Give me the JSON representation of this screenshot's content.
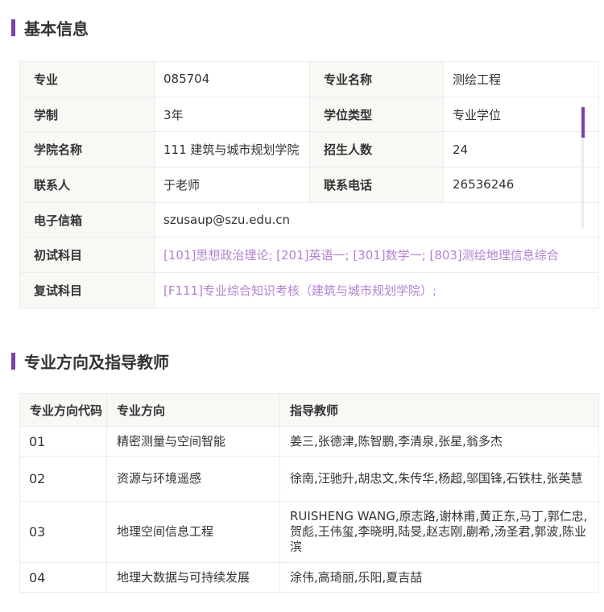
{
  "sections": {
    "basic_title": "基本信息",
    "directions_title": "专业方向及指导教师"
  },
  "basic": {
    "rows": [
      {
        "l1": "专业",
        "v1": "085704",
        "l2": "专业名称",
        "v2": "测绘工程"
      },
      {
        "l1": "学制",
        "v1": "3年",
        "l2": "学位类型",
        "v2": "专业学位"
      },
      {
        "l1": "学院名称",
        "v1": "111 建筑与城市规划学院",
        "l2": "招生人数",
        "v2": "24"
      },
      {
        "l1": "联系人",
        "v1": "于老师",
        "l2": "联系电话",
        "v2": "26536246"
      }
    ],
    "email_label": "电子信箱",
    "email_value": "szusaup@szu.edu.cn",
    "exam_label": "初试科目",
    "exam_value": "[101]思想政治理论;  [201]英语一;  [301]数学一;  [803]测绘地理信息综合",
    "retest_label": "复试科目",
    "retest_value": "[F111]专业综合知识考核（建筑与城市规划学院）;"
  },
  "directions": {
    "headers": [
      "专业方向代码",
      "专业方向",
      "指导教师"
    ],
    "rows": [
      {
        "code": "01",
        "name": "精密测量与空间智能",
        "teachers": "姜三,张德津,陈智鹏,李清泉,张星,翁多杰"
      },
      {
        "code": "02",
        "name": "资源与环境遥感",
        "teachers": "徐南,汪驰升,胡忠文,朱传华,杨超,邬国锋,石铁柱,张英慧"
      },
      {
        "code": "03",
        "name": "地理空间信息工程",
        "teachers": "RUISHENG WANG,原志路,谢林甫,黄正东,马丁,郭仁忠,贺彪,王伟玺,李晓明,陆旻,赵志刚,蒯希,汤圣君,郭波,陈业滨"
      },
      {
        "code": "04",
        "name": "地理大数据与可持续发展",
        "teachers": "涂伟,高琦丽,乐阳,夏吉喆"
      }
    ]
  },
  "colors": {
    "accent": "#7b3fb0",
    "link": "#b482d2",
    "label_bg": "#faf8f5"
  }
}
